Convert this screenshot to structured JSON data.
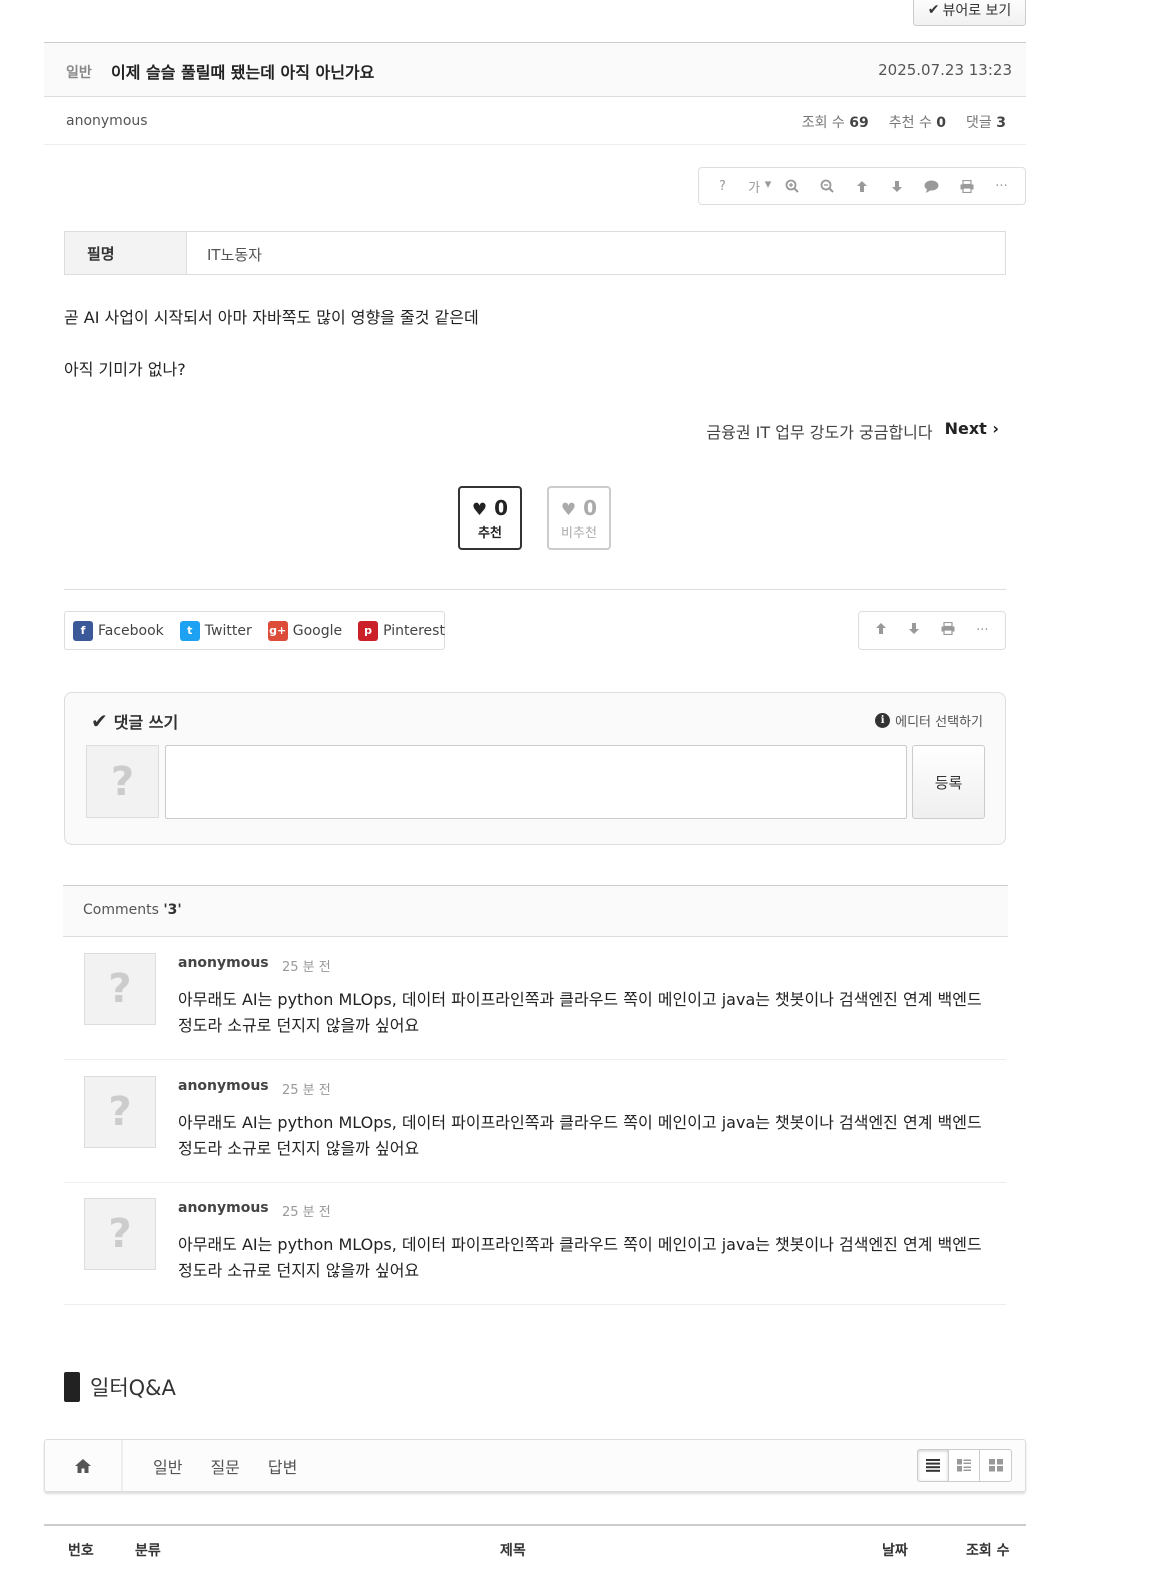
{
  "toolbar": {
    "viewer_label": "뷰어로 보기"
  },
  "post": {
    "category": "일반",
    "title": "이제 슬슬 풀릴때 됐는데 아직 아닌가요",
    "date": "2025.07.23 13:23",
    "author": "anonymous",
    "views_label": "조회 수",
    "views": "69",
    "recommend_label": "추천 수",
    "recommend": "0",
    "comments_label": "댓글",
    "comments": "3",
    "extra_field_label": "필명",
    "extra_field_value": "IT노동자",
    "body_line1": "곧 AI 사업이 시작되서 아마 자바쪽도 많이 영향을 줄것 같은데",
    "body_line2": "아직 기미가 없나?"
  },
  "doc_tools": {
    "help": "?",
    "font": "가",
    "icons": [
      "help-icon",
      "font-size-icon",
      "zoom-in-icon",
      "zoom-out-icon",
      "arrow-up-icon",
      "arrow-down-icon",
      "comment-icon",
      "print-icon",
      "more-icon"
    ]
  },
  "navigation": {
    "next_title": "금융권 IT 업무 강도가 궁금합니다",
    "next_label": "Next"
  },
  "vote": {
    "up_count": "0",
    "up_label": "추천",
    "down_count": "0",
    "down_label": "비추천"
  },
  "share": [
    {
      "label": "Facebook",
      "color": "#3b5998"
    },
    {
      "label": "Twitter",
      "color": "#1da1f2"
    },
    {
      "label": "Google",
      "color": "#dd4b39"
    },
    {
      "label": "Pinterest",
      "color": "#cb2027"
    }
  ],
  "comment_form": {
    "title": "댓글 쓰기",
    "editor_label": "에디터 선택하기",
    "submit_label": "등록",
    "textarea_value": ""
  },
  "comments": {
    "header_label": "Comments",
    "header_count": "'3'",
    "items": [
      {
        "author": "anonymous",
        "time": "25 분 전",
        "text": "아무래도 AI는 python MLOps, 데이터 파이프라인쪽과 클라우드 쪽이 메인이고 java는 챗봇이나 검색엔진 연계 백엔드 정도라 소규로 던지지 않을까 싶어요"
      },
      {
        "author": "anonymous",
        "time": "25 분 전",
        "text": "아무래도 AI는 python MLOps, 데이터 파이프라인쪽과 클라우드 쪽이 메인이고 java는 챗봇이나 검색엔진 연계 백엔드 정도라 소규로 던지지 않을까 싶어요"
      },
      {
        "author": "anonymous",
        "time": "25 분 전",
        "text": "아무래도 AI는 python MLOps, 데이터 파이프라인쪽과 클라우드 쪽이 메인이고 java는 챗봇이나 검색엔진 연계 백엔드 정도라 소규로 던지지 않을까 싶어요"
      }
    ]
  },
  "board": {
    "title": "일터Q&A",
    "tabs": [
      "일반",
      "질문",
      "답변"
    ],
    "columns": [
      "번호",
      "분류",
      "제목",
      "날짜",
      "조회 수"
    ]
  }
}
